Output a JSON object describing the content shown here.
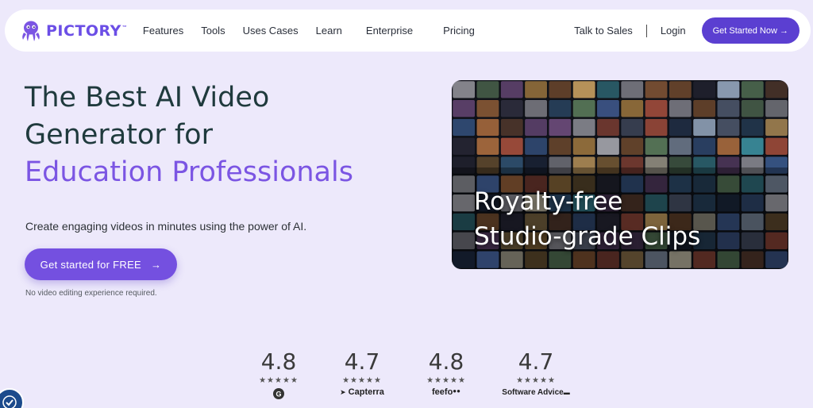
{
  "nav": {
    "logo_text": "PICTORY",
    "logo_tm": "™",
    "links": [
      "Features",
      "Tools",
      "Uses Cases",
      "Learn",
      "Enterprise",
      "Pricing"
    ],
    "talk_to_sales": "Talk to Sales",
    "login": "Login",
    "cta": "Get Started Now →"
  },
  "hero": {
    "title_line1": "The Best AI Video",
    "title_line2": "Generator for",
    "title_line3": "Education Professionals",
    "subtitle": "Create engaging videos in minutes using the power of AI.",
    "cta_label": "Get started for FREE",
    "cta_arrow": "→",
    "note": "No video editing experience required."
  },
  "media": {
    "caption_line1": "Royalty-free",
    "caption_line2": "Studio-grade Clips"
  },
  "ratings": [
    {
      "score": "4.8",
      "stars": "★★★★★",
      "brand": "G",
      "icon": "g2-logo"
    },
    {
      "score": "4.7",
      "stars": "★★★★★",
      "brand": "Capterra",
      "icon": "capterra-logo"
    },
    {
      "score": "4.8",
      "stars": "★★★★★",
      "brand": "feefo",
      "icon": "feefo-logo"
    },
    {
      "score": "4.7",
      "stars": "★★★★★",
      "brand": "Software Advice",
      "icon": "software-advice-logo"
    }
  ],
  "colors": {
    "background": "#ede9fb",
    "brand_purple": "#5b3fd1",
    "accent_purple": "#7b55e3",
    "heading": "#1f3a3d"
  }
}
